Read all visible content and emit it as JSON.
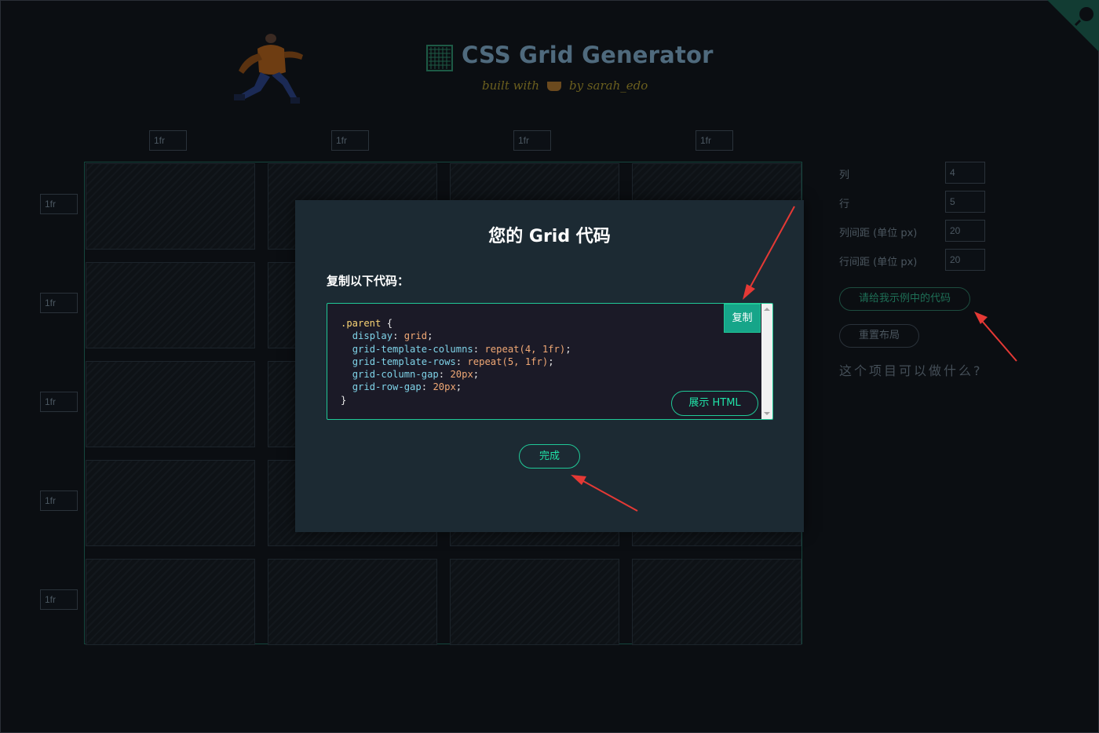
{
  "header": {
    "title": "CSS Grid Generator",
    "subtitle_left": "built with",
    "subtitle_right": "by sarah_edo"
  },
  "columns": [
    "1fr",
    "1fr",
    "1fr",
    "1fr"
  ],
  "rows": [
    "1fr",
    "1fr",
    "1fr",
    "1fr",
    "1fr"
  ],
  "sidebar": {
    "columns_label": "列",
    "columns_value": "4",
    "rows_label": "行",
    "rows_value": "5",
    "col_gap_label": "列间距 (单位 px)",
    "col_gap_value": "20",
    "row_gap_label": "行间距 (单位 px)",
    "row_gap_value": "20",
    "show_code_label": "请给我示例中的代码",
    "reset_label": "重置布局",
    "question": "这个项目可以做什么?"
  },
  "modal": {
    "title": "您的 Grid 代码",
    "prompt": "复制以下代码：",
    "copy_label": "复制",
    "show_html_label": "展示 HTML",
    "done_label": "完成",
    "code": {
      "selector": ".parent",
      "open": " {",
      "close": "}",
      "lines": [
        {
          "prop": "display",
          "value": "grid"
        },
        {
          "prop": "grid-template-columns",
          "value": "repeat(4, 1fr)"
        },
        {
          "prop": "grid-template-rows",
          "value": "repeat(5, 1fr)"
        },
        {
          "prop": "grid-column-gap",
          "value": "20px"
        },
        {
          "prop": "grid-row-gap",
          "value": "20px"
        }
      ]
    }
  },
  "colors": {
    "accent": "#20c997",
    "annotation": "#e53935",
    "background": "#0b0e12",
    "modal_bg": "#1c2a33"
  },
  "icons": [
    "grid-logo-icon",
    "runner-illustration",
    "coffee-icon",
    "github-icon",
    "arrow-annotation"
  ]
}
